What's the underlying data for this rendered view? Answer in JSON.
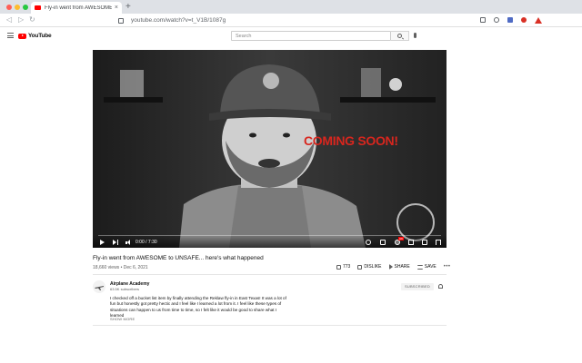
{
  "browser": {
    "tab_title": "Fly-in went from AWESOME to",
    "tab_close": "×",
    "new_tab": "+",
    "url": "youtube.com/watch?v=t_V1B/1087g"
  },
  "header": {
    "logo_text": "YouTube",
    "search_placeholder": "Search"
  },
  "video": {
    "overlay_text": "COMING SOON!",
    "time": "0:00 / 7:30",
    "progress": 0.0,
    "hd_badge": "HD",
    "title": "Fly-in went from AWESOME to UNSAFE... here's what happened",
    "meta": "18,660 views • Dec 6, 2021"
  },
  "actions": {
    "like_count": "773",
    "dislike_label": "DISLIKE",
    "share_label": "SHARE",
    "save_label": "SAVE",
    "more_label": "•••"
  },
  "channel": {
    "name": "Airplane Academy",
    "subscribers": "63.5K subscribers",
    "subscribe_label": "SUBSCRIBED",
    "description": "I checked off a bucket list item by finally attending the Reklaw fly-in in East Texas! It was a lot of fun but honestly got pretty hectic and I feel like I learned a lot from it. I feel like these types of situations can happen to us from time to time, so I felt like it would be good to share what I learned",
    "show_more": "SHOW MORE"
  }
}
